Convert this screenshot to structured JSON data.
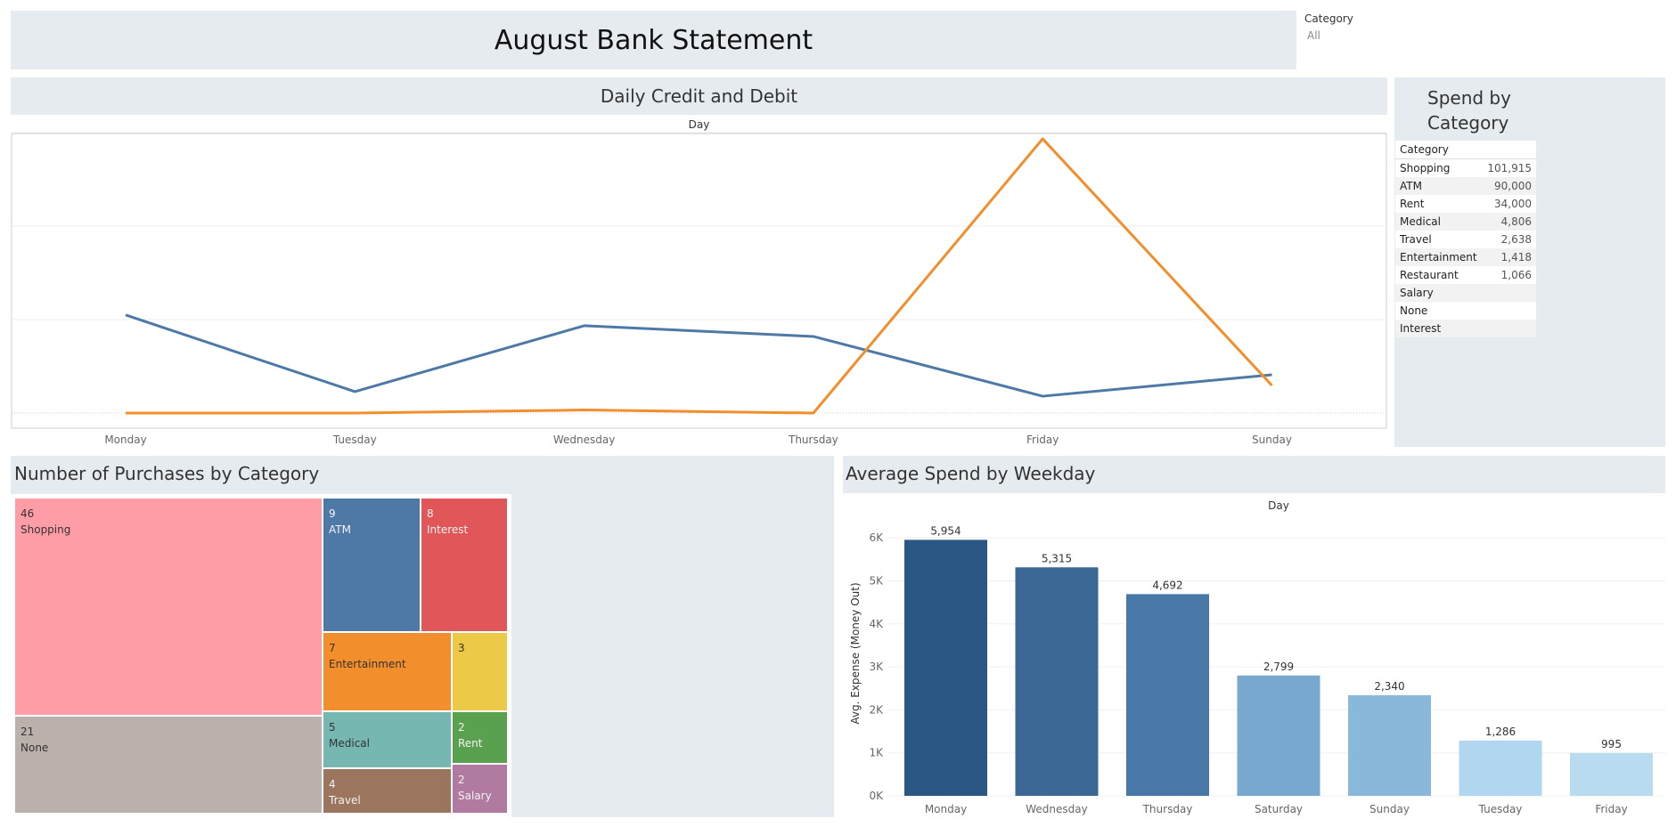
{
  "header": {
    "title": "August Bank Statement"
  },
  "filter": {
    "label": "Category",
    "value": "All"
  },
  "line_chart": {
    "title": "Daily Credit and Debit",
    "axis_title": "Day"
  },
  "spend_by_category": {
    "title_line1": "Spend by",
    "title_line2": "Category",
    "column_header": "Category",
    "rows": [
      {
        "category": "Shopping",
        "value": "101,915"
      },
      {
        "category": "ATM",
        "value": "90,000"
      },
      {
        "category": "Rent",
        "value": "34,000"
      },
      {
        "category": "Medical",
        "value": "4,806"
      },
      {
        "category": "Travel",
        "value": "2,638"
      },
      {
        "category": "Entertainment",
        "value": "1,418"
      },
      {
        "category": "Restaurant",
        "value": "1,066"
      },
      {
        "category": "Salary",
        "value": ""
      },
      {
        "category": "None",
        "value": ""
      },
      {
        "category": "Interest",
        "value": ""
      }
    ]
  },
  "treemap": {
    "title": "Number of Purchases by Category",
    "cells": [
      {
        "count": "46",
        "label": "Shopping",
        "color": "#ff9da7"
      },
      {
        "count": "21",
        "label": "None",
        "color": "#bab0ac"
      },
      {
        "count": "9",
        "label": "ATM",
        "color": "#4e79a7"
      },
      {
        "count": "8",
        "label": "Interest",
        "color": "#e15759"
      },
      {
        "count": "7",
        "label": "Entertainment",
        "color": "#f28e2b"
      },
      {
        "count": "3",
        "label": "",
        "color": "#edc948"
      },
      {
        "count": "5",
        "label": "Medical",
        "color": "#76b7b2"
      },
      {
        "count": "2",
        "label": "Rent",
        "color": "#59a14f"
      },
      {
        "count": "4",
        "label": "Travel",
        "color": "#9c755f"
      },
      {
        "count": "2",
        "label": "Salary",
        "color": "#b07aa1"
      }
    ]
  },
  "bar_chart": {
    "title": "Average Spend by Weekday",
    "axis_title": "Day",
    "ylabel": "Avg. Expense (Money Out)"
  },
  "chart_data": [
    {
      "type": "line",
      "title": "Daily Credit and Debit",
      "xlabel": "Day",
      "categories": [
        "Monday",
        "Tuesday",
        "Wednesday",
        "Thursday",
        "Friday",
        "Sunday"
      ],
      "series": [
        {
          "color": "#4e79a7",
          "values": [
            0.64,
            0.14,
            0.57,
            0.5,
            0.11,
            0.25
          ]
        },
        {
          "color": "#f28e2b",
          "values": [
            0.0,
            0.0,
            0.02,
            0.0,
            1.79,
            0.18
          ]
        }
      ],
      "note_scale": "relative",
      "ylim": [
        0,
        1.9
      ],
      "grid": true
    },
    {
      "type": "table",
      "title": "Spend by Category",
      "categories": [
        "Shopping",
        "ATM",
        "Rent",
        "Medical",
        "Travel",
        "Entertainment",
        "Restaurant",
        "Salary",
        "None",
        "Interest"
      ],
      "values": [
        101915,
        90000,
        34000,
        4806,
        2638,
        1418,
        1066,
        null,
        null,
        null
      ]
    },
    {
      "type": "treemap",
      "title": "Number of Purchases by Category",
      "categories": [
        "Shopping",
        "None",
        "ATM",
        "Interest",
        "Entertainment",
        "",
        "Medical",
        "Rent",
        "Travel",
        "Salary"
      ],
      "values": [
        46,
        21,
        9,
        8,
        7,
        3,
        5,
        2,
        4,
        2
      ]
    },
    {
      "type": "bar",
      "title": "Average Spend by Weekday",
      "xlabel": "Day",
      "ylabel": "Avg. Expense (Money Out)",
      "categories": [
        "Monday",
        "Wednesday",
        "Thursday",
        "Saturday",
        "Sunday",
        "Tuesday",
        "Friday"
      ],
      "values": [
        5954,
        5315,
        4692,
        2799,
        2340,
        1286,
        995
      ],
      "labels": [
        "5,954",
        "5,315",
        "4,692",
        "2,799",
        "2,340",
        "1,286",
        "995"
      ],
      "colors": [
        "#2a5783",
        "#3c6895",
        "#4878a8",
        "#79a8cf",
        "#89b8da",
        "#b1d6ef",
        "#b8dbf0"
      ],
      "yticks": [
        "0K",
        "1K",
        "2K",
        "3K",
        "4K",
        "5K",
        "6K"
      ],
      "ylim": [
        0,
        6500
      ],
      "grid": true
    }
  ]
}
